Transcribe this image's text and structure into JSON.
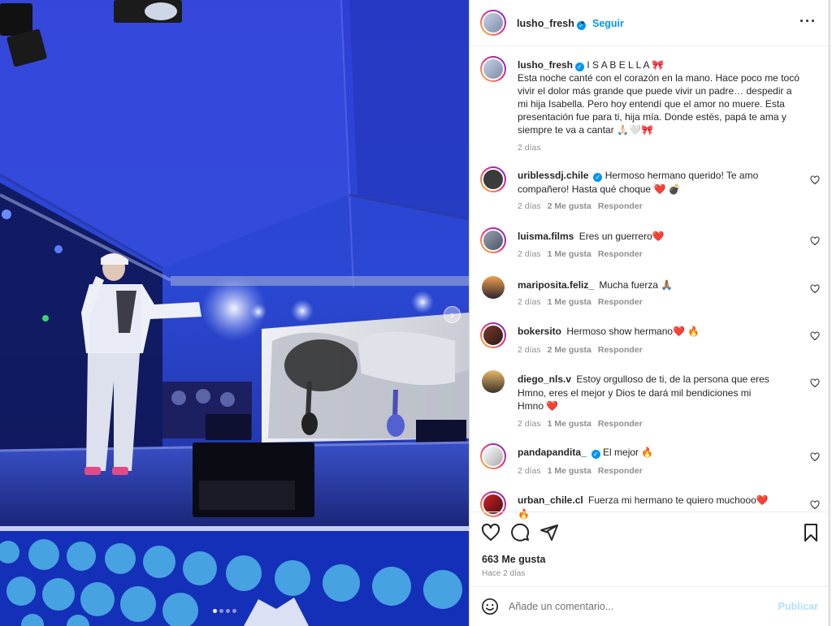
{
  "post": {
    "username": "lusho_fresh",
    "separator": "•",
    "follow_label": "Seguir",
    "more_icon": "more-horizontal-icon",
    "caption": {
      "title": "I S A B E L L A 🎀",
      "text": "Esta noche canté con el corazón en la mano. Hace poco me tocó vivir el dolor más grande que puede vivir un padre… despedir a mi hija Isabella. Pero hoy entendí que el amor no muere. Esta presentación fue para ti, hija mía. Donde estés, papá te ama y siempre te va a cantar 🙏🏻🤍🎀",
      "time": "2 días"
    }
  },
  "comments": [
    {
      "username": "uriblessdj.chile",
      "verified": true,
      "text": "Hermoso hermano querido! Te amo compañero! Hasta qué choque ❤️ 💣",
      "time": "2 días",
      "likes": "2 Me gusta",
      "reply": "Responder",
      "story_ring": true
    },
    {
      "username": "luisma.films",
      "verified": false,
      "text": "Eres un guerrero❤️",
      "time": "2 días",
      "likes": "1 Me gusta",
      "reply": "Responder",
      "story_ring": true
    },
    {
      "username": "mariposita.feliz_",
      "verified": false,
      "text": "Mucha fuerza 🙏🏽",
      "time": "2 días",
      "likes": "1 Me gusta",
      "reply": "Responder",
      "story_ring": false
    },
    {
      "username": "bokersito",
      "verified": false,
      "text": "Hermoso show hermano❤️ 🔥",
      "time": "2 días",
      "likes": "2 Me gusta",
      "reply": "Responder",
      "story_ring": true
    },
    {
      "username": "diego_nls.v",
      "verified": false,
      "text": "Estoy orgulloso de ti, de la persona que eres Hmno, eres el mejor y Dios te dará mil bendiciones mi Hmno ❤️",
      "time": "2 días",
      "likes": "1 Me gusta",
      "reply": "Responder",
      "story_ring": false
    },
    {
      "username": "pandapandita_",
      "verified": true,
      "text": "El mejor 🔥",
      "time": "2 días",
      "likes": "1 Me gusta",
      "reply": "Responder",
      "story_ring": true
    },
    {
      "username": "urban_chile.cl",
      "verified": false,
      "text": "Fuerza mi hermano te quiero muchooo❤️ 🔥",
      "time": "",
      "likes": "",
      "reply": "",
      "story_ring": true
    }
  ],
  "actions": {
    "likes_count": "663 Me gusta",
    "posted_ago": "Hace 2 días",
    "icons": [
      "heart-icon",
      "comment-icon",
      "share-icon",
      "bookmark-icon"
    ]
  },
  "composer": {
    "placeholder": "Añade un comentario...",
    "publish_label": "Publicar"
  },
  "carousel": {
    "next_icon": "chevron-right-icon",
    "slide_count": 4,
    "active_slide": 1
  },
  "colors": {
    "accent": "#0095f6",
    "like_heart": "#ed4956",
    "muted": "#8e8e8e"
  }
}
